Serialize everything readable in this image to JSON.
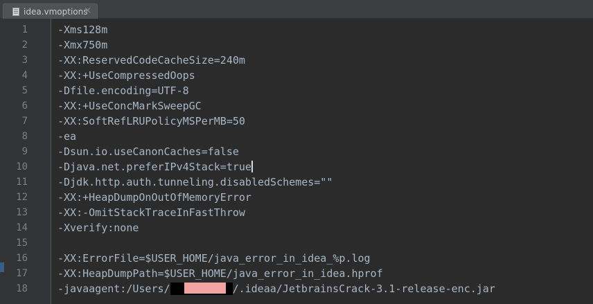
{
  "tab": {
    "label": "idea.vmoptions",
    "close_symbol": "×",
    "icon": "file-icon"
  },
  "editor": {
    "line_numbers": [
      "1",
      "2",
      "3",
      "4",
      "5",
      "6",
      "7",
      "8",
      "9",
      "10",
      "11",
      "12",
      "13",
      "14",
      "15",
      "16",
      "17",
      "18"
    ],
    "lines": [
      "-Xms128m",
      "-Xmx750m",
      "-XX:ReservedCodeCacheSize=240m",
      "-XX:+UseCompressedOops",
      "-Dfile.encoding=UTF-8",
      "-XX:+UseConcMarkSweepGC",
      "-XX:SoftRefLRUPolicyMSPerMB=50",
      "-ea",
      "-Dsun.io.useCanonCaches=false",
      "-Djava.net.preferIPv4Stack=true",
      "-Djdk.http.auth.tunneling.disabledSchemes=\"\"",
      "-XX:+HeapDumpOnOutOfMemoryError",
      "-XX:-OmitStackTraceInFastThrow",
      "-Xverify:none",
      "",
      "-XX:ErrorFile=$USER_HOME/java_error_in_idea_%p.log",
      "-XX:HeapDumpPath=$USER_HOME/java_error_in_idea.hprof"
    ],
    "line18_prefix": "-javaagent:/Users/",
    "line18_suffix": "/.ideaa/JetbrainsCrack-3.1-release-enc.jar"
  },
  "colors": {
    "background": "#2b2b2b",
    "gutter": "#313335",
    "text": "#a9b7c6",
    "line_number": "#808080",
    "redaction_pink": "#f4a3a3"
  }
}
